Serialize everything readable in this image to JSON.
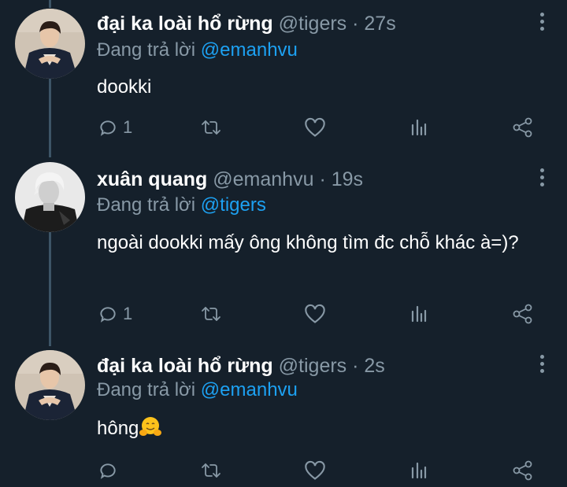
{
  "tweets": [
    {
      "name": "đại ka loài hổ rừng",
      "handle": "@tigers",
      "separator": "·",
      "time": "27s",
      "reply_prefix": "Đang trả lời",
      "reply_to": "@emanhvu",
      "text": "dookki",
      "reply_count": "1",
      "avatar": "avatar-photo-man-dark-suit"
    },
    {
      "name": "xuân quang",
      "handle": "@emanhvu",
      "separator": "·",
      "time": "19s",
      "reply_prefix": "Đang trả lời",
      "reply_to": "@tigers",
      "text": "ngoài dookki mấy ông không tìm đc chỗ khác à=)?",
      "reply_count": "1",
      "avatar": "avatar-photo-blonde-bw"
    },
    {
      "name": "đại ka loài hổ rừng",
      "handle": "@tigers",
      "separator": "·",
      "time": "2s",
      "reply_prefix": "Đang trả lời",
      "reply_to": "@emanhvu",
      "text": "hông",
      "emoji": "hugging-face-emoji",
      "reply_count": "",
      "avatar": "avatar-photo-man-dark-suit"
    }
  ],
  "icons": {
    "reply": "reply-icon",
    "retweet": "retweet-icon",
    "like": "heart-icon",
    "analytics": "analytics-icon",
    "share": "share-icon",
    "more": "more-options-icon"
  },
  "colors": {
    "background": "#15202b",
    "secondary_text": "#8899a6",
    "link": "#1da1f2",
    "thread_line": "#3d5466"
  }
}
